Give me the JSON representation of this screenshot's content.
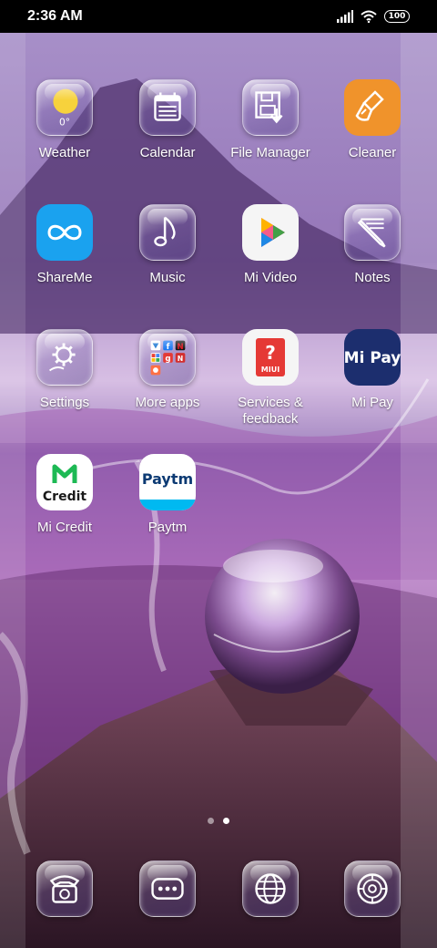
{
  "status_bar": {
    "time": "2:36 AM",
    "battery": "100",
    "icons": [
      "signal-icon",
      "wifi-icon",
      "battery-icon"
    ]
  },
  "apps": [
    {
      "label": "Weather",
      "icon": "weather-icon",
      "temp": "0°"
    },
    {
      "label": "Calendar",
      "icon": "calendar-icon"
    },
    {
      "label": "File Manager",
      "icon": "file-manager-icon"
    },
    {
      "label": "Cleaner",
      "icon": "cleaner-icon"
    },
    {
      "label": "ShareMe",
      "icon": "shareme-icon"
    },
    {
      "label": "Music",
      "icon": "music-icon"
    },
    {
      "label": "Mi Video",
      "icon": "mi-video-icon"
    },
    {
      "label": "Notes",
      "icon": "notes-icon"
    },
    {
      "label": "Settings",
      "icon": "settings-icon"
    },
    {
      "label": "More apps",
      "icon": "folder-icon"
    },
    {
      "label": "Services & feedback",
      "icon": "services-feedback-icon",
      "badge": "MIUI"
    },
    {
      "label": "Mi Pay",
      "icon": "mi-pay-icon",
      "logo_text": "Mi Pay"
    },
    {
      "label": "Mi Credit",
      "icon": "mi-credit-icon",
      "logo_text": "Credit"
    },
    {
      "label": "Paytm",
      "icon": "paytm-icon",
      "logo_text": "Paytm"
    }
  ],
  "dock": [
    {
      "icon": "phone-icon"
    },
    {
      "icon": "messages-icon"
    },
    {
      "icon": "browser-icon"
    },
    {
      "icon": "camera-icon"
    }
  ],
  "page_indicator": {
    "pages": 2,
    "current": 2
  },
  "colors": {
    "cleaner": "#f0932b",
    "shareme": "#1aa2ef",
    "mi_pay": "#1c2e6e",
    "services": "#e53935",
    "paytm_blue": "#0c3a73",
    "paytm_cyan": "#00b9f1"
  }
}
